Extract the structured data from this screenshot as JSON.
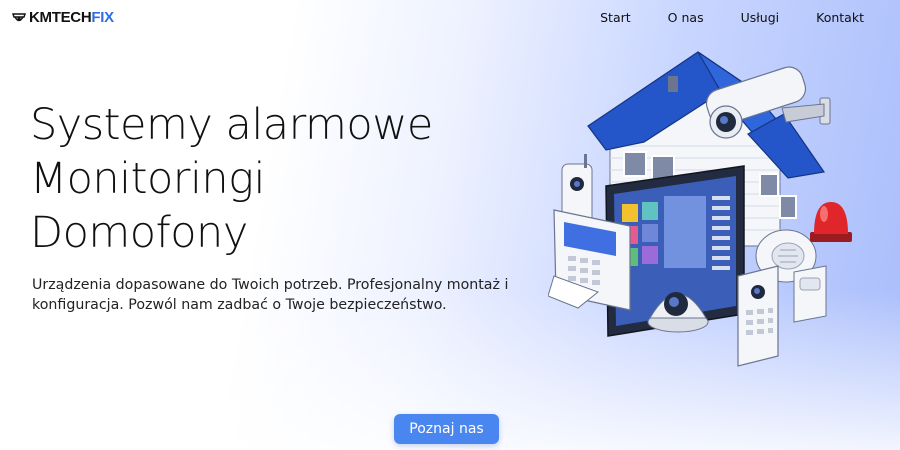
{
  "brand": {
    "name_part1": "KMTECH",
    "name_part2": "FIX",
    "icon": "camera-icon"
  },
  "nav": {
    "items": [
      {
        "label": "Start"
      },
      {
        "label": "O nas"
      },
      {
        "label": "Usługi"
      },
      {
        "label": "Kontakt"
      }
    ]
  },
  "hero": {
    "lines": [
      "Systemy alarmowe",
      "Monitoringi",
      "Domofony"
    ],
    "description": "Urządzenia dopasowane do Twoich potrzeb. Profesjonalny montaż i konfiguracja. Pozwól nam zadbać o Twoje bezpieczeństwo.",
    "cta_label": "Poznaj nas",
    "illustration": "smart-home-security-illustration"
  },
  "colors": {
    "accent": "#4a86f0",
    "brand_blue": "#2f6fe4",
    "roof_blue": "#2456c9",
    "alarm_red": "#e0262b",
    "text": "#111111"
  }
}
